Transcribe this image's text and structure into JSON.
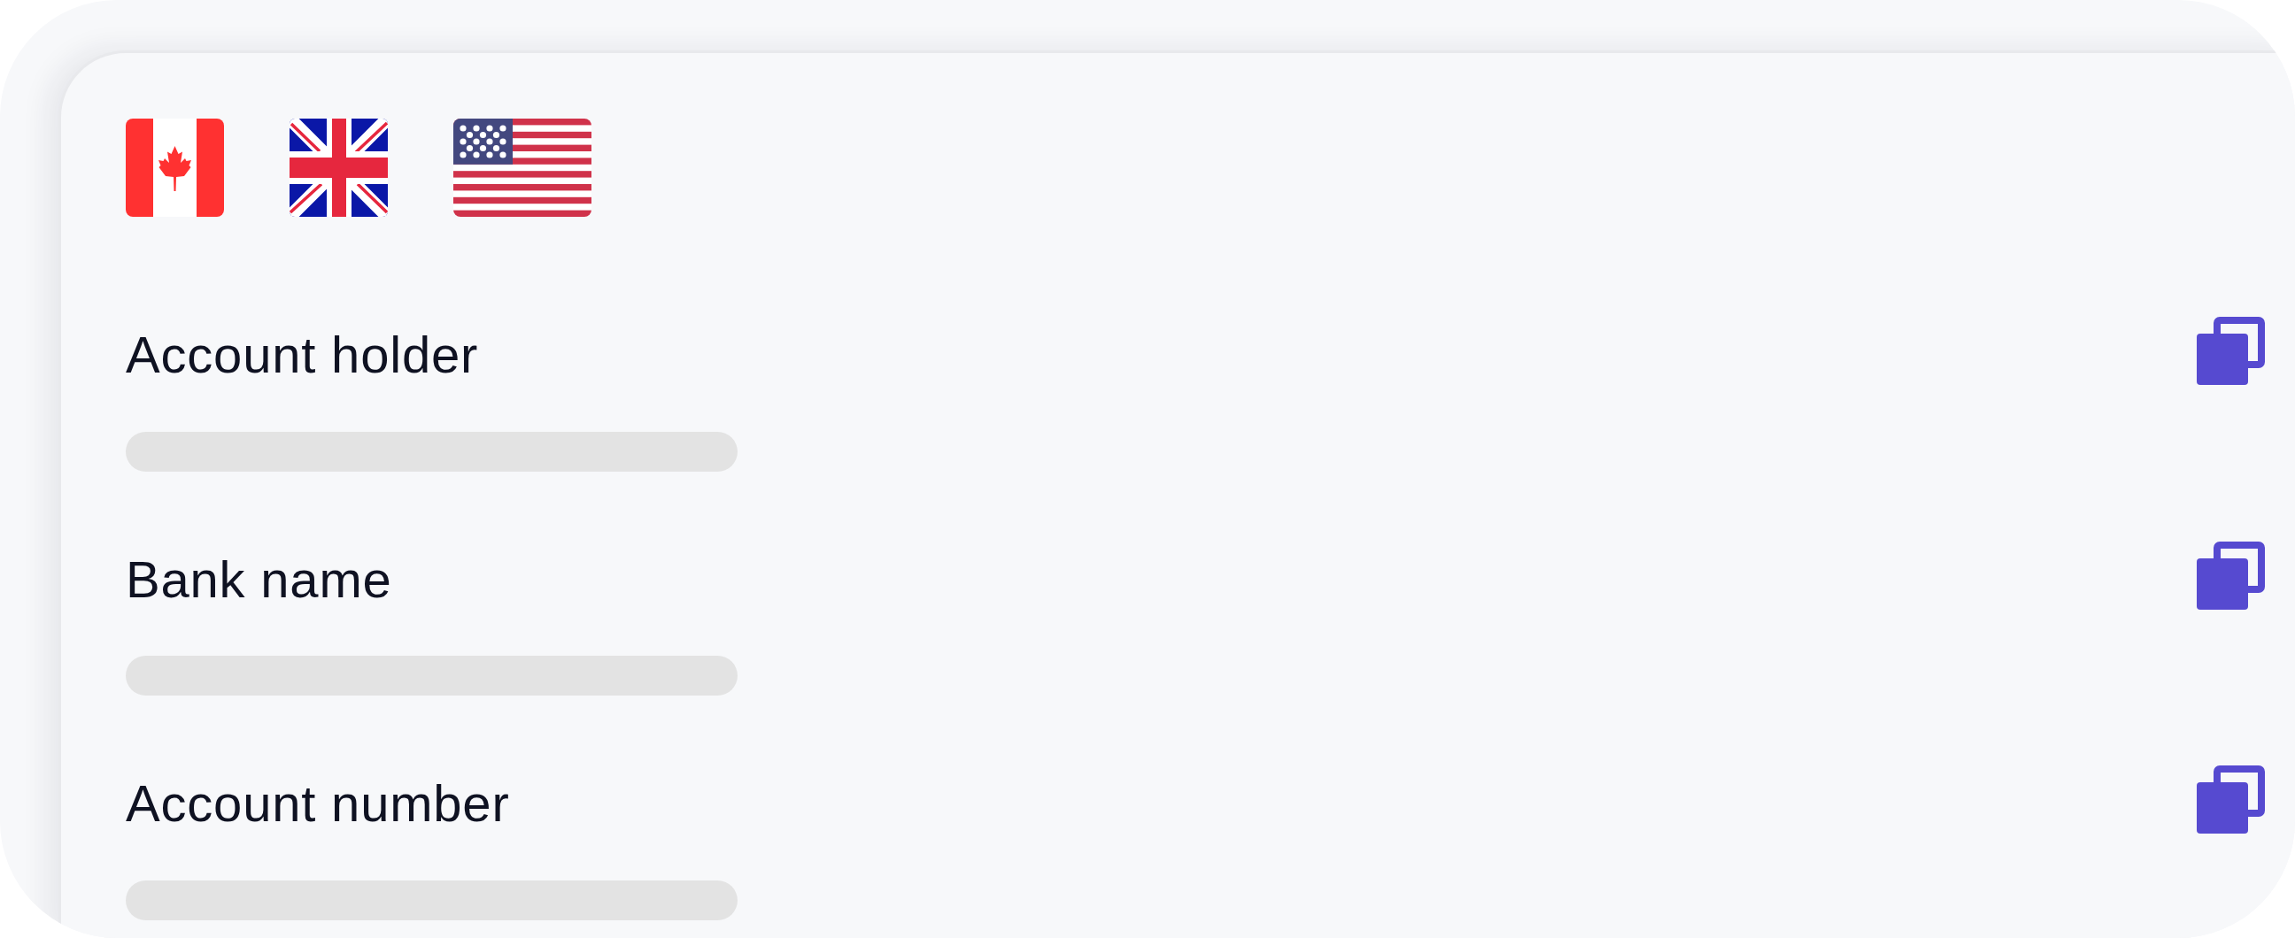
{
  "fields": [
    {
      "label": "Account holder",
      "loading": true
    },
    {
      "label": "Bank name",
      "loading": true
    },
    {
      "label": "Account number",
      "loading": true
    }
  ]
}
